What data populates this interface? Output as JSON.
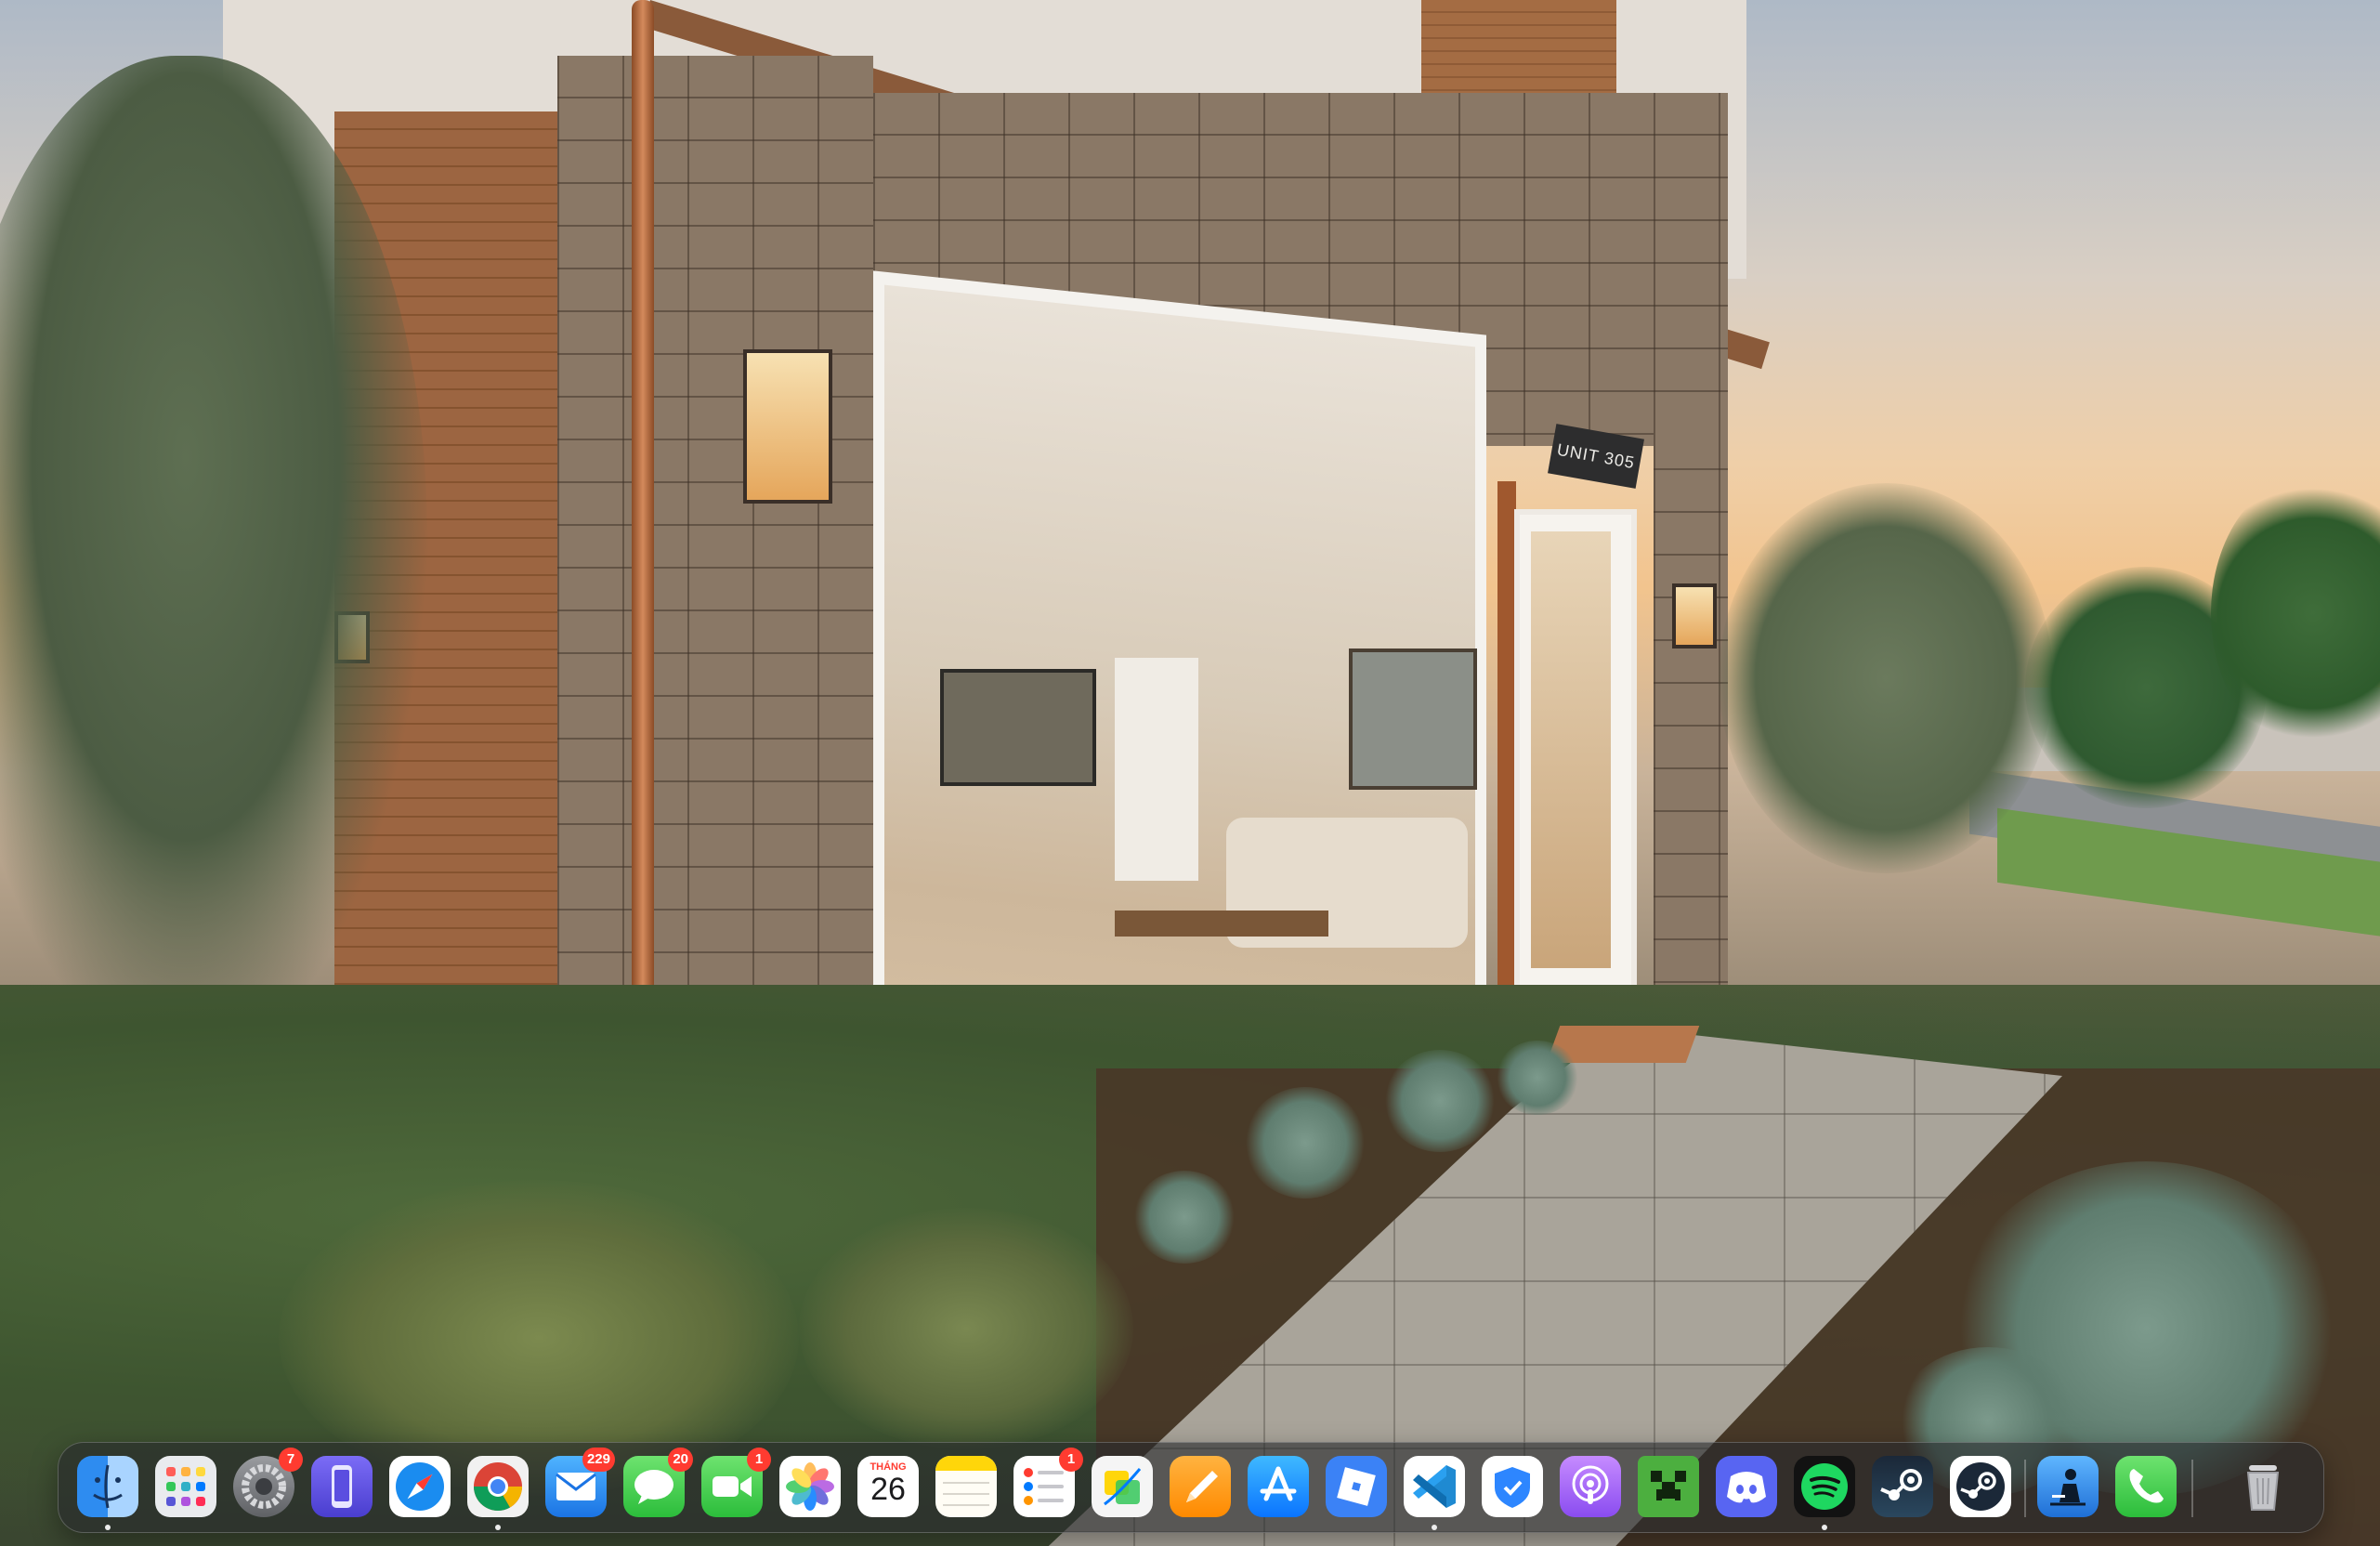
{
  "wallpaper": {
    "unit_sign": "UNIT 305"
  },
  "dock": {
    "items": [
      {
        "name": "Finder",
        "icon": "finder-icon",
        "running": true
      },
      {
        "name": "Launchpad",
        "icon": "launchpad-icon",
        "running": false
      },
      {
        "name": "System Settings",
        "icon": "gear-icon",
        "badge": "7",
        "running": false
      },
      {
        "name": "Simulator",
        "icon": "simulator-icon",
        "running": false
      },
      {
        "name": "Safari",
        "icon": "compass-icon",
        "running": false
      },
      {
        "name": "Google Chrome",
        "icon": "chrome-icon",
        "running": true
      },
      {
        "name": "Mail",
        "icon": "envelope-icon",
        "badge": "229",
        "running": false
      },
      {
        "name": "Messages",
        "icon": "chat-bubble-icon",
        "badge": "20",
        "running": false
      },
      {
        "name": "FaceTime",
        "icon": "video-camera-icon",
        "badge": "1",
        "running": false
      },
      {
        "name": "Photos",
        "icon": "photos-flower-icon",
        "running": false
      },
      {
        "name": "Calendar",
        "icon": "calendar-icon",
        "month": "THÁNG",
        "day": "26",
        "running": false
      },
      {
        "name": "Notes",
        "icon": "notes-icon",
        "running": false
      },
      {
        "name": "Reminders",
        "icon": "checklist-icon",
        "badge": "1",
        "running": false
      },
      {
        "name": "Freeform",
        "icon": "freeform-icon",
        "running": false
      },
      {
        "name": "Pages",
        "icon": "pen-icon",
        "running": false
      },
      {
        "name": "App Store",
        "icon": "app-store-icon",
        "running": false
      },
      {
        "name": "Roblox",
        "icon": "roblox-icon",
        "running": false
      },
      {
        "name": "Visual Studio Code",
        "icon": "vscode-icon",
        "running": true
      },
      {
        "name": "Security",
        "icon": "shield-icon",
        "running": false
      },
      {
        "name": "Podcast App",
        "icon": "podcast-icon",
        "running": false
      },
      {
        "name": "Minecraft",
        "icon": "creeper-icon",
        "running": false
      },
      {
        "name": "Discord",
        "icon": "discord-icon",
        "running": false
      },
      {
        "name": "Spotify",
        "icon": "spotify-icon",
        "running": true
      },
      {
        "name": "Steam",
        "icon": "steam-icon",
        "running": false
      },
      {
        "name": "Steam Link",
        "icon": "steam-link-icon",
        "running": false
      },
      {
        "name": "Kindle",
        "icon": "kindle-reader-icon",
        "running": false
      },
      {
        "name": "Phone",
        "icon": "phone-icon",
        "running": false
      },
      {
        "name": "Trash",
        "icon": "trash-icon",
        "running": false
      }
    ],
    "colors": {
      "badge": "#ff3b30",
      "dock_background": "#26282c"
    }
  }
}
